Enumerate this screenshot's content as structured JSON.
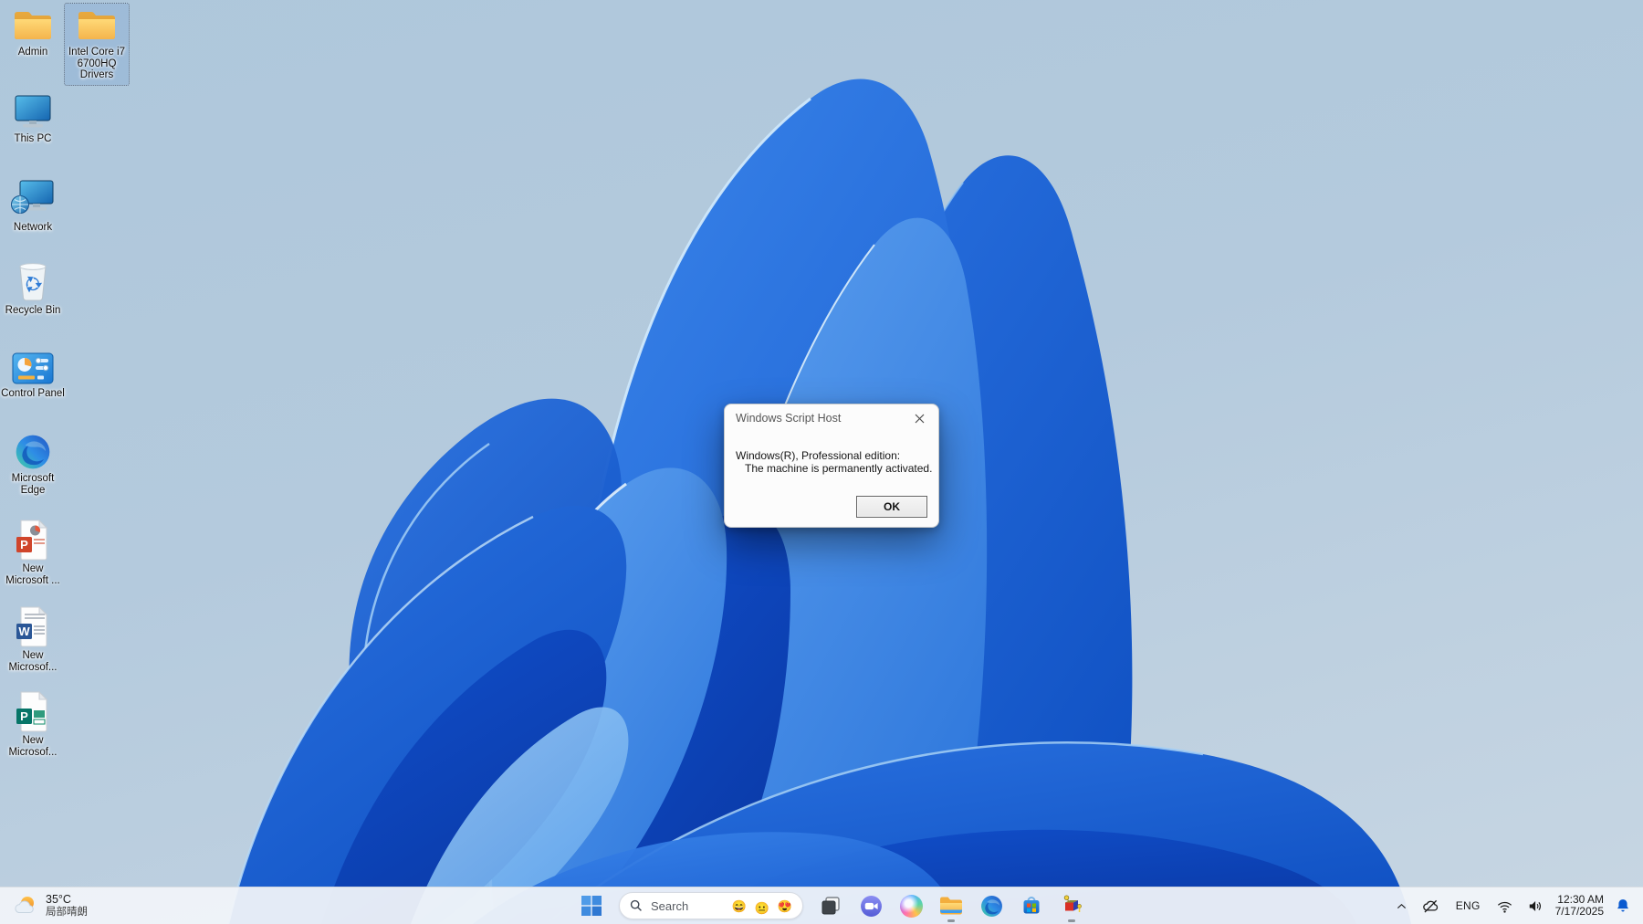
{
  "colors": {
    "desktop_selection": "rgba(125,165,212,0.34)",
    "taskbar_bg": "#f1f4f9",
    "dialog_bg": "#fcfcfc",
    "notification_bell": "#0a5ad0",
    "bloom_deep_blue": "#0c44bc",
    "bloom_light_blue": "#5fa2f0"
  },
  "desktop": {
    "icons": [
      {
        "name": "admin",
        "icon": "folder-icon",
        "label": "Admin",
        "selected": false
      },
      {
        "name": "intel-core-i7-6700hq-drivers",
        "icon": "folder-icon",
        "selected": true,
        "lines": [
          "Intel Core i7",
          "6700HQ",
          "Drivers"
        ]
      },
      {
        "name": "this-pc",
        "icon": "computer-icon",
        "label": "This PC",
        "selected": false
      },
      {
        "name": "network",
        "icon": "network-icon",
        "label": "Network",
        "selected": false
      },
      {
        "name": "recycle-bin",
        "icon": "recycle-bin-icon",
        "label": "Recycle Bin",
        "selected": false
      },
      {
        "name": "control-panel",
        "icon": "control-panel-icon",
        "label": "Control Panel",
        "selected": false
      },
      {
        "name": "microsoft-edge",
        "icon": "edge-icon",
        "lines": [
          "Microsoft",
          "Edge"
        ],
        "selected": false
      },
      {
        "name": "new-microsoft-powerpoint",
        "icon": "powerpoint-file-icon",
        "lines": [
          "New",
          "Microsoft ..."
        ],
        "selected": false
      },
      {
        "name": "new-microsoft-word",
        "icon": "word-file-icon",
        "lines": [
          "New",
          "Microsof..."
        ],
        "selected": false
      },
      {
        "name": "new-microsoft-publisher",
        "icon": "publisher-file-icon",
        "lines": [
          "New",
          "Microsof..."
        ],
        "selected": false
      }
    ]
  },
  "dialog": {
    "title": "Windows Script Host",
    "close_icon": "close-icon",
    "message_line1": "Windows(R), Professional edition:",
    "message_line2": "The machine is permanently activated.",
    "ok_label": "OK"
  },
  "taskbar": {
    "weather": {
      "temperature": "35°C",
      "condition": "局部晴朗",
      "icon": "sun-cloud-icon"
    },
    "start": {
      "icon": "windows-start-icon"
    },
    "search": {
      "placeholder": "Search",
      "icon": "search-icon",
      "emojis": [
        "😄",
        "😐",
        "😍"
      ]
    },
    "apps": [
      {
        "name": "task-view",
        "running": false
      },
      {
        "name": "chat",
        "running": false
      },
      {
        "name": "copilot",
        "running": false
      },
      {
        "name": "file-explorer",
        "running": true
      },
      {
        "name": "edge",
        "running": false
      },
      {
        "name": "microsoft-store",
        "running": false
      },
      {
        "name": "activation-tool",
        "running": true
      }
    ],
    "tray": {
      "hidden_icons": "chevron-up-icon",
      "onedrive": "cloud-off-icon",
      "language": "ENG",
      "network": "wifi-icon",
      "volume": "speaker-icon",
      "time": "12:30 AM",
      "date": "7/17/2025",
      "notifications": "bell-icon"
    }
  }
}
